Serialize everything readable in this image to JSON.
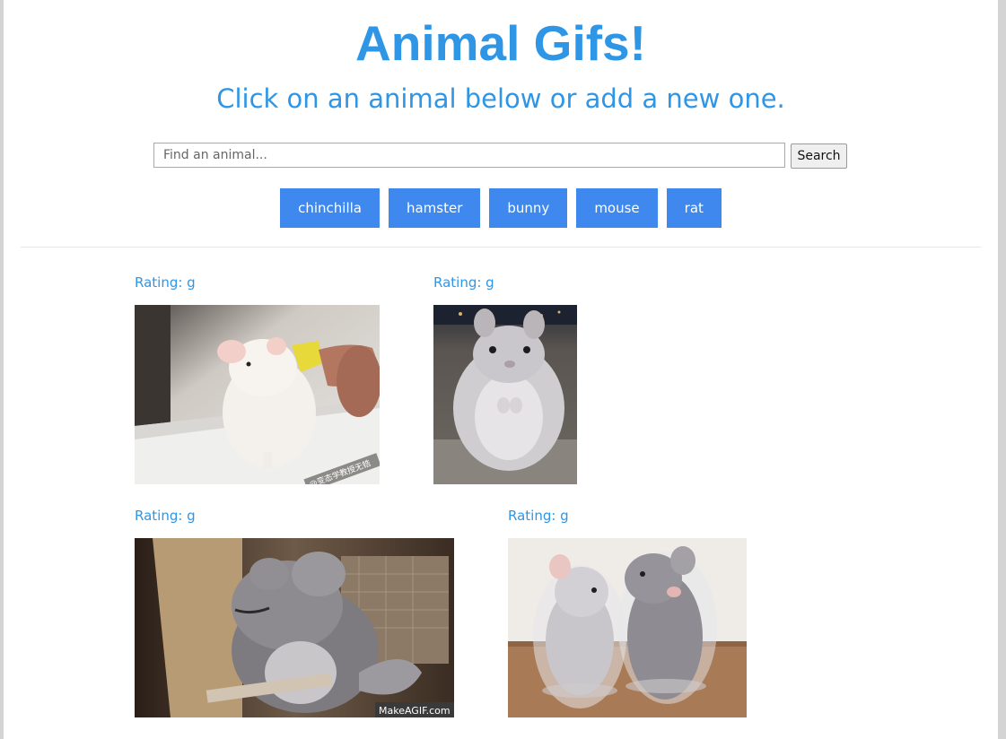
{
  "header": {
    "title": "Animal Gifs!",
    "subtitle": "Click on an animal below or add a new one."
  },
  "search": {
    "placeholder": "Find an animal...",
    "value": "",
    "button_label": "Search"
  },
  "animals": [
    "chinchilla",
    "hamster",
    "bunny",
    "mouse",
    "rat"
  ],
  "gifs": [
    {
      "rating_label": "Rating: g",
      "watermark": "@变态学教授无锆"
    },
    {
      "rating_label": "Rating: g",
      "watermark": ""
    },
    {
      "rating_label": "Rating: g",
      "watermark": "MakeAGIF.com"
    },
    {
      "rating_label": "Rating: g",
      "watermark": ""
    }
  ],
  "colors": {
    "accent_text": "#2f96e6",
    "button_bg": "#3f88ee",
    "button_text": "#ffffff"
  }
}
